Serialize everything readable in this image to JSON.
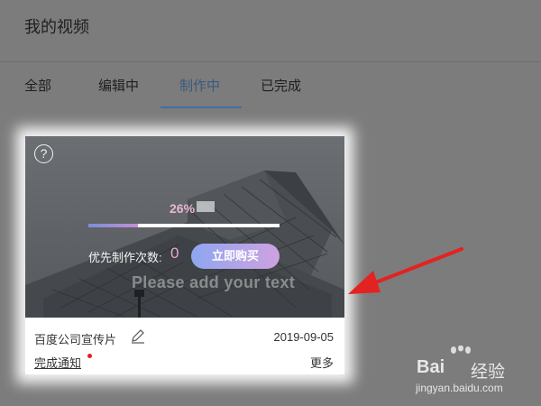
{
  "header": {
    "title": "我的视频"
  },
  "tabs": [
    {
      "label": "全部"
    },
    {
      "label": "编辑中"
    },
    {
      "label": "制作中",
      "active": true
    },
    {
      "label": "已完成"
    }
  ],
  "card": {
    "help_icon": "?",
    "progress": {
      "text": "26%",
      "value": 0.26
    },
    "priority_label": "优先制作次数:",
    "priority_count": "0",
    "buy_button": "立即购买",
    "watermark": "Please add your text",
    "title": "百度公司宣传片",
    "date": "2019-09-05",
    "notify_link": "完成通知",
    "more_link": "更多"
  },
  "icons": {
    "help": "question-circle-icon",
    "edit": "pencil-icon",
    "annotation": "red-arrow-icon"
  },
  "colors": {
    "overlay": "#7c7c7c",
    "active_tab": "#3f6f9f",
    "progress_text": "#e7b7d6",
    "annotation_arrow": "#e32222",
    "notify_dot": "#e02020"
  },
  "watermark_brand": {
    "text": "Bai",
    "text_cn": "经验",
    "url": "jingyan.baidu.com"
  }
}
